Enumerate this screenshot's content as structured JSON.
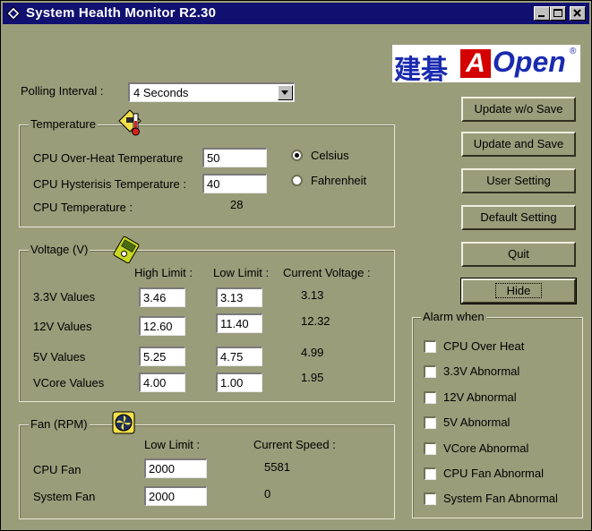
{
  "window": {
    "title": "System Health Monitor R2.30",
    "icon": "diamond-app-icon",
    "controls": [
      "minimize",
      "maximize",
      "close"
    ]
  },
  "logo": {
    "chinese": "建碁",
    "brand_a": "A",
    "brand_rest": "Open",
    "registered": "®",
    "colors": {
      "chinese": "#1a2bb0",
      "a_box": "#d40000",
      "open": "#1a2bb0"
    }
  },
  "polling": {
    "label": "Polling Interval :",
    "selected": "4 Seconds"
  },
  "temperature": {
    "title": "Temperature",
    "icon": "thermometer-icon",
    "overheat_label": "CPU Over-Heat Temperature",
    "overheat_value": "50",
    "hysteresis_label": "CPU Hysterisis Temperature :",
    "hysteresis_value": "40",
    "current_label": "CPU Temperature :",
    "current_value": "28",
    "unit_celsius": "Celsius",
    "unit_fahrenheit": "Fahrenheit",
    "selected_unit": "Celsius"
  },
  "voltage": {
    "title": "Voltage (V)",
    "icon": "voltmeter-icon",
    "headers": {
      "high": "High Limit :",
      "low": "Low Limit :",
      "current": "Current Voltage :"
    },
    "rows": [
      {
        "label": "3.3V Values",
        "high": "3.46",
        "low": "3.13",
        "current": "3.13"
      },
      {
        "label": "12V Values",
        "high": "12.60",
        "low": "11.40",
        "current": "12.32"
      },
      {
        "label": "5V Values",
        "high": "5.25",
        "low": "4.75",
        "current": "4.99"
      },
      {
        "label": "VCore Values",
        "high": "4.00",
        "low": "1.00",
        "current": "1.95"
      }
    ]
  },
  "fan": {
    "title": "Fan (RPM)",
    "icon": "fan-icon",
    "headers": {
      "low": "Low Limit :",
      "current": "Current Speed :"
    },
    "rows": [
      {
        "label": "CPU Fan",
        "low": "2000",
        "current": "5581"
      },
      {
        "label": "System Fan",
        "low": "2000",
        "current": "0"
      }
    ]
  },
  "buttons": {
    "update_nosave": "Update w/o Save",
    "update_save": "Update and Save",
    "user_setting": "User Setting",
    "default_setting": "Default Setting",
    "quit": "Quit",
    "hide": "Hide"
  },
  "alarm": {
    "title": "Alarm when",
    "items": [
      "CPU Over Heat",
      "3.3V Abnormal",
      "12V Abnormal",
      "5V Abnormal",
      "VCore Abnormal",
      "CPU Fan Abnormal",
      "System Fan Abnormal"
    ]
  }
}
